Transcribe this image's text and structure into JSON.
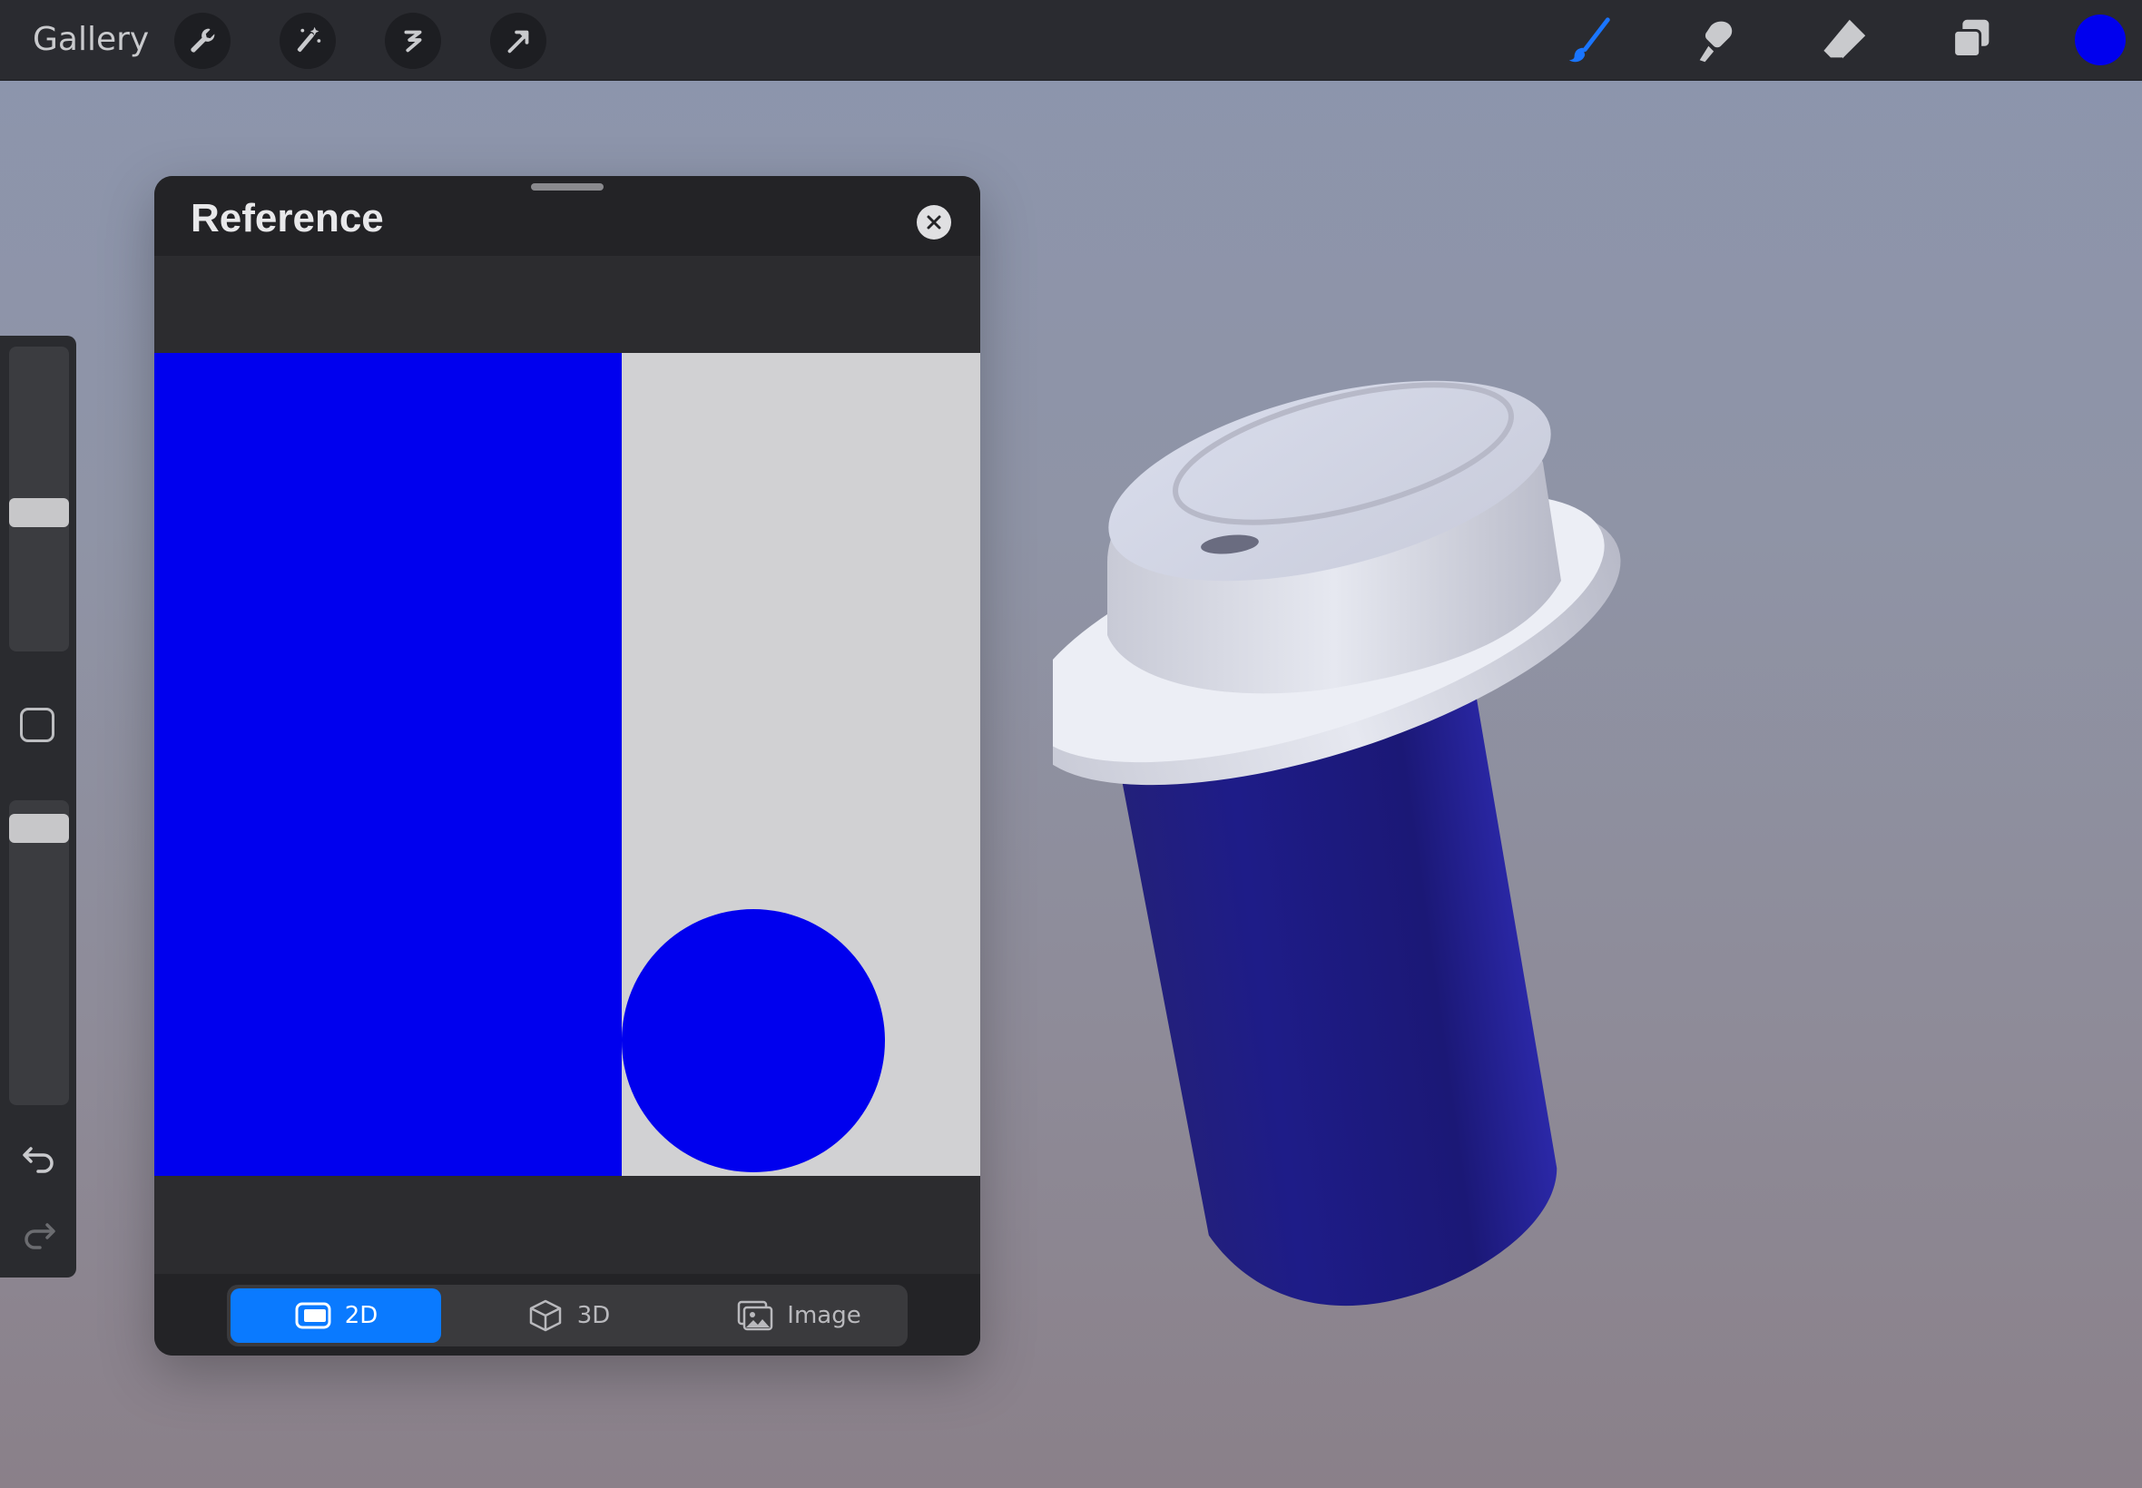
{
  "toolbar": {
    "gallery_label": "Gallery",
    "left_tools": [
      "wrench-icon",
      "magic-wand-icon",
      "selection-icon",
      "transform-arrow-icon"
    ],
    "right_tools": [
      "brush-icon",
      "smudge-icon",
      "eraser-icon",
      "layers-icon"
    ],
    "active_tool": "brush-icon",
    "active_color": "#0000ee",
    "accent_color": "#1a75ff"
  },
  "sidebar": {
    "brush_size_level": 0.45,
    "opacity_level": 0.05,
    "icons": [
      "modify-square-icon",
      "undo-icon",
      "redo-icon"
    ]
  },
  "reference": {
    "title": "Reference",
    "image": {
      "background": "#d1d1d3",
      "rect_color": "#0000ee",
      "circle_color": "#0000ee"
    },
    "modes": [
      {
        "label": "2D",
        "icon": "2d-icon",
        "active": true
      },
      {
        "label": "3D",
        "icon": "3d-cube-icon",
        "active": false
      },
      {
        "label": "Image",
        "icon": "image-icon",
        "active": false
      }
    ],
    "active_mode_color": "#0a7aff"
  },
  "canvas": {
    "object": "coffee-cup-3d",
    "cup_body_color": "#1c1a80",
    "lid_color": "#d4d6e0"
  }
}
